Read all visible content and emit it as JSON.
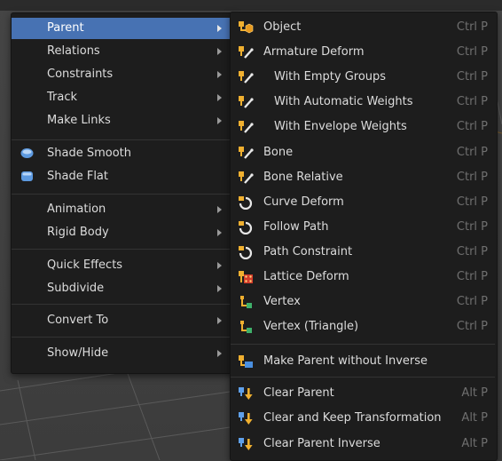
{
  "left_menu": {
    "items": [
      {
        "label": "Parent",
        "has_submenu": true,
        "active": true
      },
      {
        "label": "Relations",
        "has_submenu": true
      },
      {
        "label": "Constraints",
        "has_submenu": true
      },
      {
        "label": "Track",
        "has_submenu": true
      },
      {
        "label": "Make Links",
        "has_submenu": true
      },
      {
        "label": "Shade Smooth",
        "icon": "shade-smooth-icon"
      },
      {
        "label": "Shade Flat",
        "icon": "shade-flat-icon"
      },
      {
        "label": "Animation",
        "has_submenu": true
      },
      {
        "label": "Rigid Body",
        "has_submenu": true
      },
      {
        "label": "Quick Effects",
        "has_submenu": true
      },
      {
        "label": "Subdivide",
        "has_submenu": true
      },
      {
        "label": "Convert To",
        "has_submenu": true
      },
      {
        "label": "Show/Hide",
        "has_submenu": true
      }
    ]
  },
  "parent_menu": {
    "items": [
      {
        "label": "Object",
        "shortcut": "Ctrl P",
        "icon": "object-parent-icon"
      },
      {
        "label": "Armature Deform",
        "shortcut": "Ctrl P",
        "icon": "armature-deform-icon"
      },
      {
        "label": "With Empty Groups",
        "shortcut": "Ctrl P",
        "icon": "armature-deform-icon",
        "indent": true
      },
      {
        "label": "With Automatic Weights",
        "shortcut": "Ctrl P",
        "icon": "armature-deform-icon",
        "indent": true
      },
      {
        "label": "With Envelope Weights",
        "shortcut": "Ctrl P",
        "icon": "armature-deform-icon",
        "indent": true
      },
      {
        "label": "Bone",
        "shortcut": "Ctrl P",
        "icon": "bone-parent-icon"
      },
      {
        "label": "Bone Relative",
        "shortcut": "Ctrl P",
        "icon": "bone-parent-icon"
      },
      {
        "label": "Curve Deform",
        "shortcut": "Ctrl P",
        "icon": "curve-deform-icon"
      },
      {
        "label": "Follow Path",
        "shortcut": "Ctrl P",
        "icon": "curve-deform-icon"
      },
      {
        "label": "Path Constraint",
        "shortcut": "Ctrl P",
        "icon": "curve-deform-icon"
      },
      {
        "label": "Lattice Deform",
        "shortcut": "Ctrl P",
        "icon": "lattice-deform-icon"
      },
      {
        "label": "Vertex",
        "shortcut": "Ctrl P",
        "icon": "vertex-parent-icon"
      },
      {
        "label": "Vertex (Triangle)",
        "shortcut": "Ctrl P",
        "icon": "vertex-parent-icon"
      },
      {
        "label": "Make Parent without Inverse",
        "shortcut": "",
        "icon": "parent-no-inverse-icon"
      },
      {
        "label": "Clear Parent",
        "shortcut": "Alt P",
        "icon": "clear-parent-icon"
      },
      {
        "label": "Clear and Keep Transformation",
        "shortcut": "Alt P",
        "icon": "clear-parent-icon"
      },
      {
        "label": "Clear Parent Inverse",
        "shortcut": "Alt P",
        "icon": "clear-parent-icon"
      }
    ]
  },
  "colors": {
    "accent": "#4772b3",
    "menu_bg": "#1d1d1d",
    "shortcut": "#6f6f6f"
  }
}
